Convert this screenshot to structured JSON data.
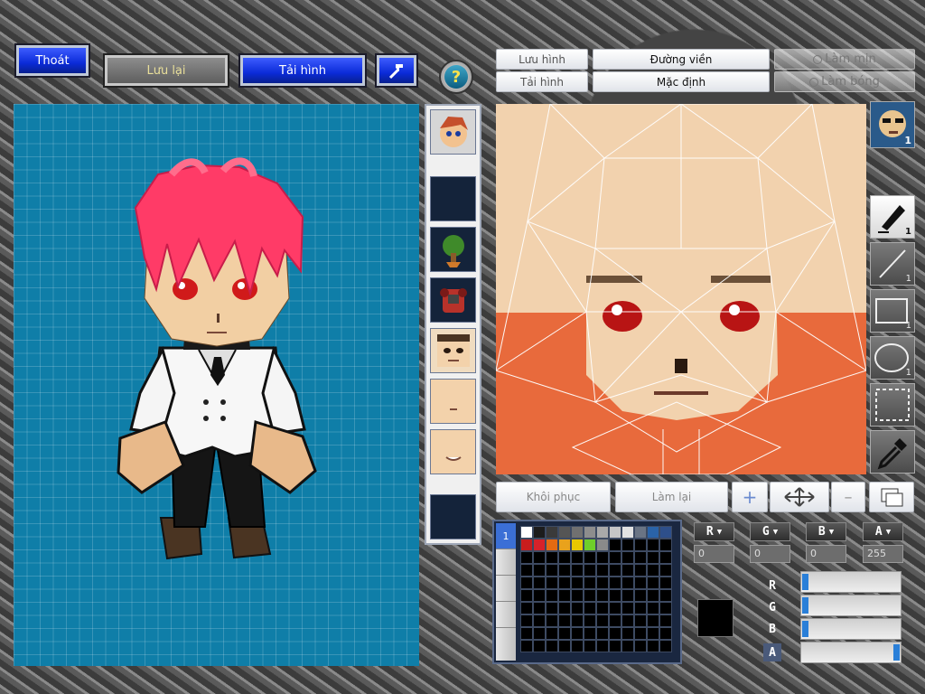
{
  "toolbar": {
    "exit_label": "Thoát",
    "save_label": "Lưu lại",
    "load_label": "Tải hình",
    "help_glyph": "?"
  },
  "editor_top": {
    "save_image_label": "Lưu hình",
    "load_image_label": "Tải hình",
    "outline_label": "Đường viền",
    "default_label": "Mặc định",
    "smooth_label": "Làm mịn",
    "shade_label": "Làm bóng"
  },
  "editor_bottom": {
    "restore_label": "Khôi phục",
    "redo_label": "Làm lại"
  },
  "icons": {
    "hammer": "hammer-icon",
    "help": "help-icon",
    "pen": "pen-icon",
    "line": "line-icon",
    "rect": "rectangle-icon",
    "ellipse": "ellipse-icon",
    "select": "selection-icon",
    "eyedropper": "eyedropper-icon"
  },
  "tools": {
    "pen_size": "1",
    "line_size": "1",
    "rect_size": "1",
    "ellipse_size": "1",
    "preview_count": "1"
  },
  "color": {
    "r_label": "R",
    "g_label": "G",
    "b_label": "B",
    "a_label": "A",
    "r_value": "0",
    "g_value": "0",
    "b_value": "0",
    "a_value": "255",
    "current_hex": "#000000",
    "tab_label": "1",
    "r_level": 0,
    "g_level": 0,
    "b_level": 0,
    "a_level": 1
  },
  "palette": [
    "#ffffff",
    "#1c1c1c",
    "#3a3a3a",
    "#555555",
    "#707070",
    "#8d8d8d",
    "#a9a9a9",
    "#c6c6c6",
    "#e2e2e2",
    "#6a7484",
    "#2a63a8",
    "#2e4f8a",
    "#c81d1d",
    "#d7222a",
    "#e46a12",
    "#e9a21c",
    "#e8c800",
    "#6fcf2a",
    "#8a8a8a"
  ],
  "colors": {
    "accent_blue": "#0b2bd8",
    "canvas_blue": "#0f7ea8",
    "hair_red": "#ff3b67"
  }
}
